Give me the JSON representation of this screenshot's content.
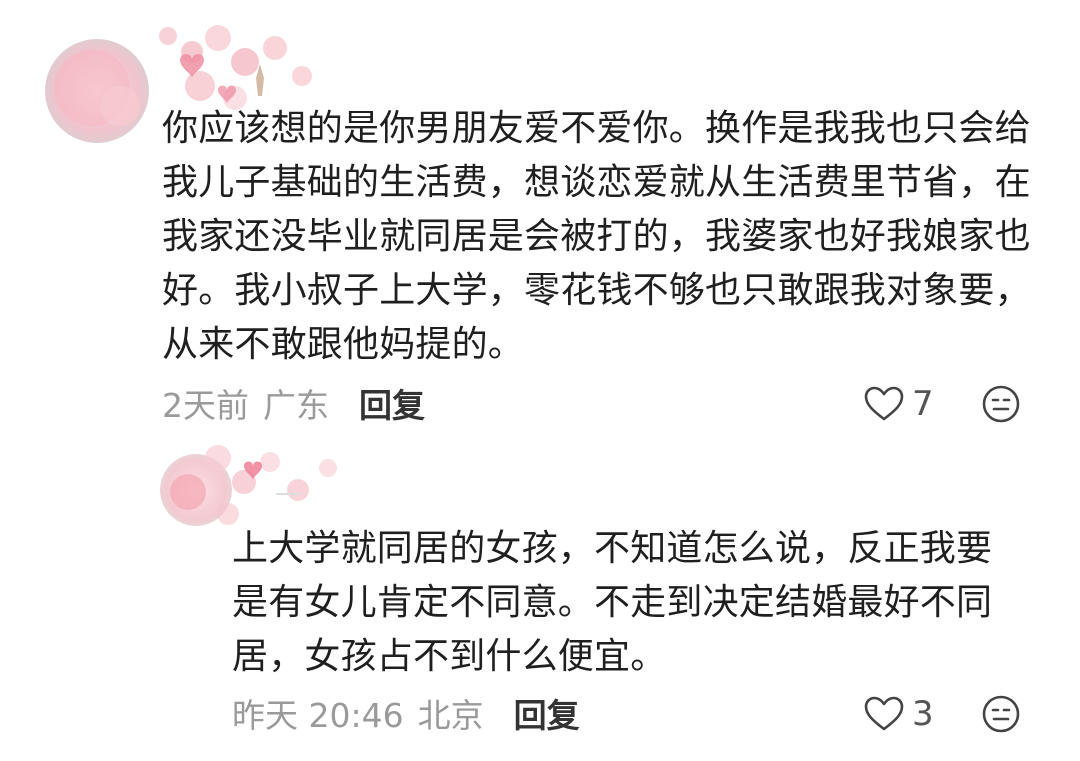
{
  "comments": [
    {
      "text": "你应该想的是你男朋友爱不爱你。换作是我我也只会给我儿子基础的生活费，想谈恋爱就从生活费里节省，在我家还没毕业就同居是会被打的，我婆家也好我娘家也好。我小叔子上大学，零花钱不够也只敢跟我对象要，从来不敢跟他妈提的。",
      "time": "2天前",
      "location": "广东",
      "reply_label": "回复",
      "likes": "7",
      "replies": [
        {
          "text": "上大学就同居的女孩，不知道怎么说，反正我要是有女儿肯定不同意。不走到决定结婚最好不同居，女孩占不到什么便宜。",
          "time": "昨天 20:46",
          "location": "北京",
          "reply_label": "回复",
          "likes": "3"
        }
      ]
    }
  ],
  "icons": {
    "like": "heart-outline-icon",
    "dislike": "meh-face-icon"
  },
  "colors": {
    "text": "#1f1f1f",
    "meta": "#9a9a9a",
    "heart_pink": "#f3a7b4"
  }
}
